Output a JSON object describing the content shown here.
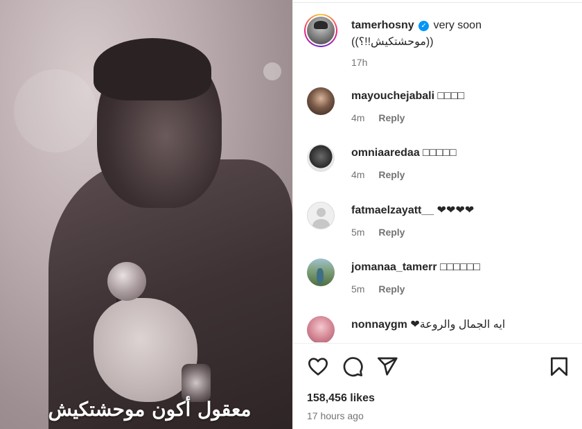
{
  "media": {
    "caption_overlay": "معقول أكون موحشتكيش"
  },
  "post": {
    "author": "tamerhosny",
    "verified_mark": "✓",
    "caption_line1": "very soon",
    "caption_line2": "((موحشتكيش!!؟))",
    "time": "17h"
  },
  "comments": [
    {
      "username": "mayouchejabali",
      "text": "□□□□",
      "time": "4m",
      "reply": "Reply"
    },
    {
      "username": "omniaaredaa",
      "text": "□□□□□",
      "time": "4m",
      "reply": "Reply"
    },
    {
      "username": "fatmaelzayatt__",
      "text": "❤❤❤❤",
      "time": "5m",
      "reply": "Reply"
    },
    {
      "username": "jomanaa_tamerr",
      "text": "□□□□□□",
      "time": "5m",
      "reply": "Reply"
    },
    {
      "username": "nonnaygm",
      "text": "ايه الجمال والروعة❤",
      "time": "",
      "reply": ""
    }
  ],
  "actions": {
    "like_icon": "heart-icon",
    "comment_icon": "comment-icon",
    "share_icon": "share-icon",
    "save_icon": "bookmark-icon"
  },
  "likes": "158,456 likes",
  "posted_ago": "17 hours ago",
  "colors": {
    "verified": "#0095f6",
    "secondary_text": "#737373",
    "primary_text": "#262626"
  }
}
